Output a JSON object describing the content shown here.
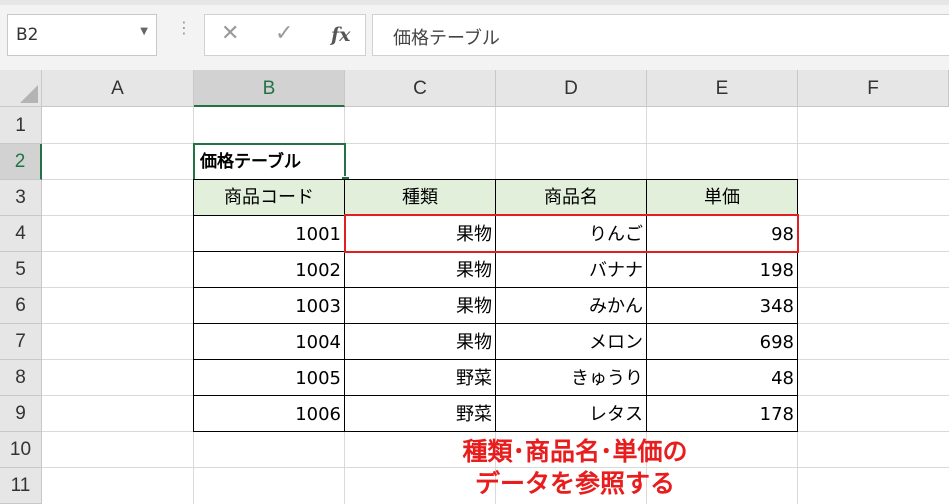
{
  "formula_bar": {
    "name_box": "B2",
    "cancel_icon": "✕",
    "enter_icon": "✓",
    "fx_label": "fx",
    "formula": "価格テーブル"
  },
  "columns": [
    "A",
    "B",
    "C",
    "D",
    "E",
    "F"
  ],
  "rows": [
    "1",
    "2",
    "3",
    "4",
    "5",
    "6",
    "7",
    "8",
    "9",
    "10",
    "11"
  ],
  "table": {
    "title": "価格テーブル",
    "headers": [
      "商品コード",
      "種類",
      "商品名",
      "単価"
    ],
    "rows": [
      [
        "1001",
        "果物",
        "りんご",
        "98"
      ],
      [
        "1002",
        "果物",
        "バナナ",
        "198"
      ],
      [
        "1003",
        "果物",
        "みかん",
        "348"
      ],
      [
        "1004",
        "果物",
        "メロン",
        "698"
      ],
      [
        "1005",
        "野菜",
        "きゅうり",
        "48"
      ],
      [
        "1006",
        "野菜",
        "レタス",
        "178"
      ]
    ]
  },
  "annotation": {
    "line1": "種類･商品名･単価の",
    "line2": "データを参照する"
  },
  "colors": {
    "header_fill": "#e2efda",
    "selection": "#217346",
    "highlight": "#e02020"
  }
}
